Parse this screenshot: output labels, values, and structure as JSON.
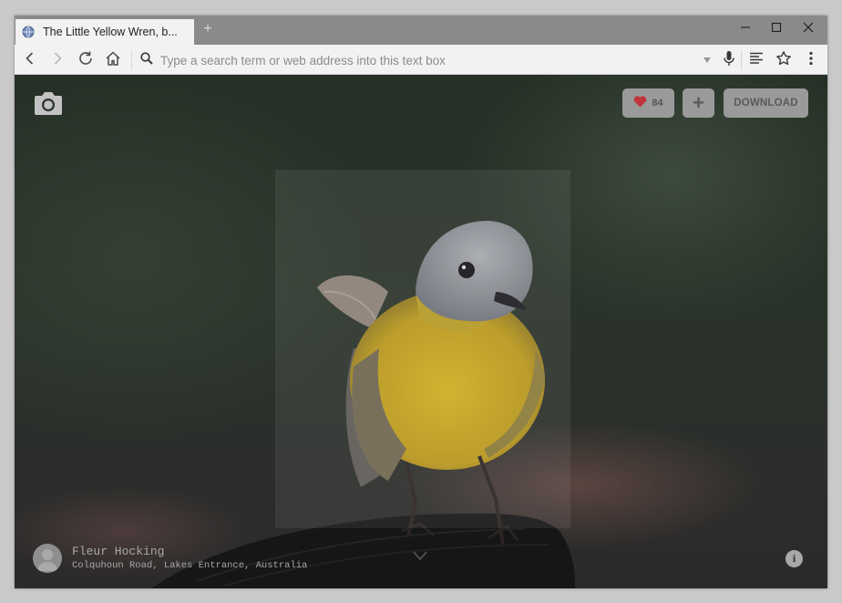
{
  "browser": {
    "tab_title": "The Little Yellow Wren, b...",
    "new_tab_symbol": "+",
    "address_placeholder": "Type a search term or web address into this text box",
    "icons": [
      "globe-icon",
      "back-arrow-icon",
      "forward-arrow-icon",
      "reload-icon",
      "home-icon",
      "search-icon",
      "dropdown-triangle-icon",
      "microphone-icon",
      "reader-view-icon",
      "bookmark-star-icon",
      "menu-dots-icon",
      "minimize-icon",
      "maximize-icon",
      "close-icon"
    ]
  },
  "page": {
    "like_count": "84",
    "add_symbol": "+",
    "download_label": "DOWNLOAD",
    "author": "Fleur Hocking",
    "location": "Colquhoun Road, Lakes Entrance, Australia",
    "info_symbol": "i",
    "icons": [
      "camera-icon",
      "heart-icon",
      "chevron-down-icon",
      "info-icon",
      "avatar-placeholder-icon"
    ]
  },
  "colors": {
    "heart": "#c0353b",
    "button_bg": "#9a9a9a",
    "bird_yellow": "#c9a81e",
    "bird_gray": "#8e9298"
  }
}
